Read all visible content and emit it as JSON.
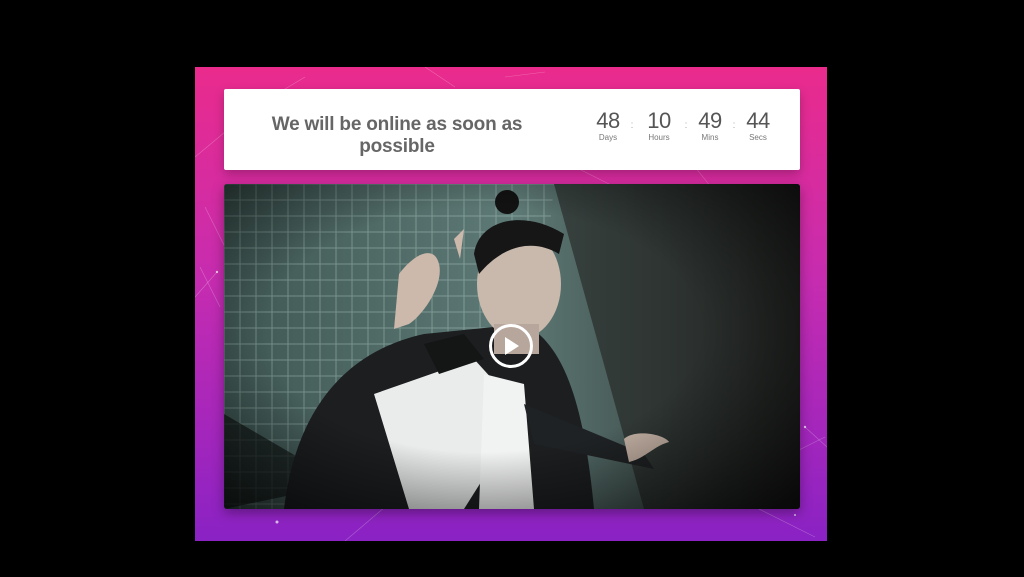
{
  "page": {
    "background_color": "#000000",
    "gradient_top": "#ea2b8c",
    "gradient_bottom": "#8a22c4"
  },
  "header": {
    "headline": "We will be online as soon as possible"
  },
  "countdown": {
    "days": {
      "value": "48",
      "label": "Days"
    },
    "hours": {
      "value": "10",
      "label": "Hours"
    },
    "mins": {
      "value": "49",
      "label": "Mins"
    },
    "secs": {
      "value": "44",
      "label": "Secs"
    },
    "separator": ":"
  },
  "video": {
    "play_icon": "play-icon"
  }
}
